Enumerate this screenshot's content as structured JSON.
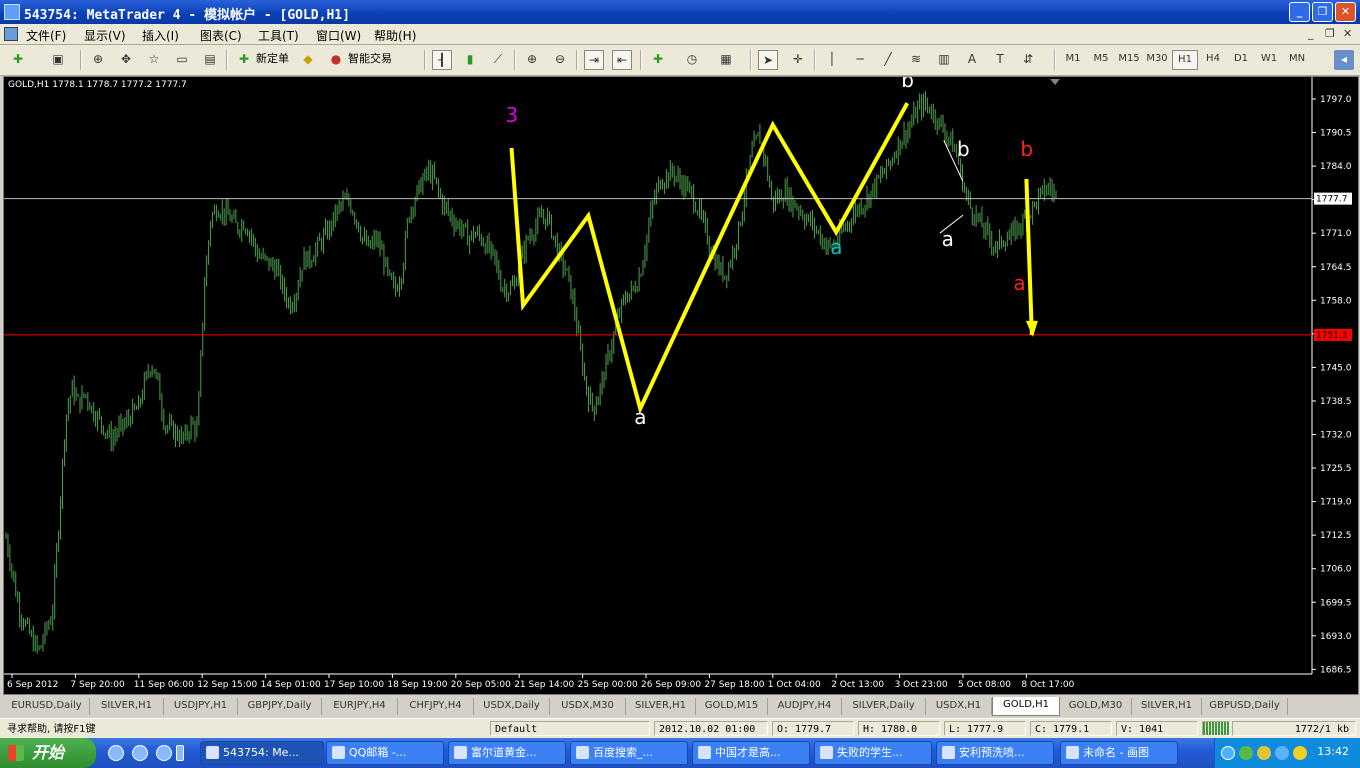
{
  "window": {
    "title": "543754: MetaTrader 4 - 模拟帐户 - [GOLD,H1]"
  },
  "menu": [
    {
      "key": "file",
      "label": "文件(F)"
    },
    {
      "key": "view",
      "label": "显示(V)"
    },
    {
      "key": "insert",
      "label": "插入(I)"
    },
    {
      "key": "charts",
      "label": "图表(C)"
    },
    {
      "key": "tools",
      "label": "工具(T)"
    },
    {
      "key": "window",
      "label": "窗口(W)"
    },
    {
      "key": "help",
      "label": "帮助(H)"
    }
  ],
  "toolbar": {
    "new_order": "新定单",
    "expert_advisors": "智能交易",
    "timeframes": [
      "M1",
      "M5",
      "M15",
      "M30",
      "H1",
      "H4",
      "D1",
      "W1",
      "MN"
    ],
    "active_timeframe": "H1",
    "text_tool": "A",
    "icons": [
      "new-chart-icon",
      "profiles-icon",
      "market-watch-icon",
      "navigator-icon",
      "terminal-icon",
      "strategy-tester-icon",
      "new-order-icon",
      "alert-icon",
      "expert-advisors-icon",
      "bar-chart-icon",
      "candlestick-icon",
      "line-chart-icon",
      "zoom-in-icon",
      "zoom-out-icon",
      "chart-shift-icon",
      "autoscroll-icon",
      "indicators-icon",
      "periods-icon",
      "templates-icon",
      "cursor-icon",
      "crosshair-icon",
      "vertical-line-icon",
      "horizontal-line-icon",
      "trendline-icon",
      "fibonacci-icon",
      "text-label-icon",
      "arrows-icon",
      "expand-icon"
    ]
  },
  "chart": {
    "symbol_info": "GOLD,H1  1778.1 1778.7 1777.2 1777.7",
    "current_price_label": "1777.7",
    "red_line_label": "1751.3",
    "colors": {
      "background": "#000000",
      "bars": "#4fa04f",
      "wave": "#ffff00",
      "red_line": "#ff0000",
      "price_line": "#bfbfbf",
      "axis_text": "#ffffff"
    }
  },
  "chart_data": {
    "type": "bar",
    "symbol": "GOLD",
    "timeframe": "H1",
    "ylim": [
      1684.4,
      1800.3
    ],
    "y_ticks": [
      "1797.0",
      "1790.5",
      "1784.0",
      "1777.4",
      "1771.0",
      "1764.5",
      "1758.0",
      "1751.3",
      "1745.0",
      "1738.5",
      "1732.0",
      "1725.5",
      "1719.0",
      "1712.5",
      "1706.0",
      "1699.5",
      "1693.0",
      "1686.5"
    ],
    "x_ticks": [
      "6 Sep 2012",
      "7 Sep 20:00",
      "11 Sep 06:00",
      "12 Sep 15:00",
      "14 Sep 01:00",
      "17 Sep 10:00",
      "18 Sep 19:00",
      "20 Sep 05:00",
      "21 Sep 14:00",
      "25 Sep 00:00",
      "26 Sep 09:00",
      "27 Sep 18:00",
      "1 Oct 04:00",
      "2 Oct 13:00",
      "3 Oct 23:00",
      "5 Oct 08:00",
      "8 Oct 17:00"
    ],
    "close_profile": [
      1712,
      1705,
      1698,
      1695,
      1692,
      1690,
      1694,
      1697,
      1715,
      1735,
      1741,
      1738,
      1740,
      1737,
      1735,
      1733,
      1731,
      1733,
      1734,
      1736,
      1737,
      1742,
      1746,
      1742,
      1734,
      1733,
      1732,
      1731,
      1734,
      1733,
      1760,
      1774,
      1776,
      1775,
      1774,
      1772,
      1773,
      1771,
      1767,
      1766,
      1765,
      1764,
      1760,
      1757,
      1760,
      1766,
      1766,
      1768,
      1770,
      1772,
      1775,
      1777,
      1777,
      1774,
      1770,
      1768,
      1770,
      1767,
      1762,
      1760,
      1764,
      1775,
      1778,
      1781,
      1783,
      1781,
      1777,
      1775,
      1773,
      1772,
      1770,
      1771,
      1770,
      1768,
      1766,
      1761,
      1760,
      1761,
      1766,
      1770,
      1772,
      1774,
      1774,
      1770,
      1766,
      1763,
      1757,
      1748,
      1740,
      1737,
      1741,
      1746,
      1751,
      1756,
      1759,
      1760,
      1763,
      1770,
      1777,
      1781,
      1782,
      1783,
      1781,
      1780,
      1778,
      1775,
      1771,
      1767,
      1764,
      1763,
      1767,
      1772,
      1780,
      1787,
      1790,
      1785,
      1777,
      1778,
      1779,
      1777,
      1776,
      1774,
      1773,
      1771,
      1769,
      1768,
      1770,
      1772,
      1774,
      1776,
      1777,
      1779,
      1781,
      1783,
      1785,
      1788,
      1790,
      1792,
      1795,
      1796,
      1795,
      1793,
      1791,
      1789,
      1786,
      1780,
      1776,
      1774,
      1772,
      1770,
      1768,
      1770,
      1770,
      1772,
      1773,
      1775,
      1777,
      1779,
      1780,
      1778
    ],
    "current_price": 1777.7,
    "red_line_price": 1751.3,
    "wave_path": [
      {
        "t": "21 Sep 10:00",
        "price": 1787.5
      },
      {
        "t": "21 Sep 19:00",
        "price": 1757.0
      },
      {
        "t": "25 Sep 03:00",
        "price": 1774.4
      },
      {
        "t": "26 Sep 06:00",
        "price": 1737.0
      },
      {
        "t": "1 Oct 04:00",
        "price": 1792.0
      },
      {
        "t": "2 Oct 13:00",
        "price": 1771.2
      },
      {
        "t": "4 Oct 03:00",
        "price": 1796.2
      }
    ],
    "drop_arrow": [
      {
        "t": "8 Oct 17:00",
        "price": 1781.5
      },
      {
        "t": "9 Oct 00:00",
        "price": 1751.3
      }
    ],
    "annotations": [
      {
        "text": "3",
        "color": "#e000e0",
        "t": "21 Sep 10:00",
        "price": 1792.5
      },
      {
        "text": "a",
        "color": "#ffffff",
        "t": "26 Sep 06:00",
        "price": 1734.0
      },
      {
        "text": "b",
        "color": "#ffffff",
        "t": "4 Oct 03:00",
        "price": 1799.3
      },
      {
        "text": "a",
        "color": "#00c0c0",
        "t": "2 Oct 13:00",
        "price": 1767.0
      },
      {
        "text": "b",
        "color": "#ffffff",
        "t": "5 Oct 08:00",
        "price": 1786.0
      },
      {
        "text": "a",
        "color": "#ffffff",
        "t": "5 Oct 00:00",
        "price": 1768.5
      },
      {
        "text": "b",
        "color": "#ff2020",
        "t": "8 Oct 17:00",
        "price": 1786.0
      },
      {
        "text": "a",
        "color": "#ff2020",
        "t": "8 Oct 08:00",
        "price": 1760.0
      }
    ]
  },
  "tabs": [
    {
      "label": "EURUSD,Daily",
      "active": false
    },
    {
      "label": "SILVER,H1",
      "active": false
    },
    {
      "label": "USDJPY,H1",
      "active": false
    },
    {
      "label": "GBPJPY,Daily",
      "active": false
    },
    {
      "label": "EURJPY,H4",
      "active": false
    },
    {
      "label": "CHFJPY,H4",
      "active": false
    },
    {
      "label": "USDX,Daily",
      "active": false
    },
    {
      "label": "USDX,M30",
      "active": false
    },
    {
      "label": "SILVER,H1",
      "active": false
    },
    {
      "label": "GOLD,M15",
      "active": false
    },
    {
      "label": "AUDJPY,H4",
      "active": false
    },
    {
      "label": "SILVER,Daily",
      "active": false
    },
    {
      "label": "USDX,H1",
      "active": false
    },
    {
      "label": "GOLD,H1",
      "active": true
    },
    {
      "label": "GOLD,M30",
      "active": false
    },
    {
      "label": "SILVER,H1",
      "active": false
    },
    {
      "label": "GBPUSD,Daily",
      "active": false
    }
  ],
  "status": {
    "help": "寻求帮助, 请按F1键",
    "profile": "Default",
    "datetime": "2012.10.02 01:00",
    "open": "O: 1779.7",
    "high": "H: 1780.0",
    "low": "L: 1777.9",
    "close": "C: 1779.1",
    "volume": "V: 1041",
    "traffic": "1772/1 kb"
  },
  "taskbar": {
    "start_label": "开始",
    "tasks": [
      {
        "label": "543754: Me..."
      },
      {
        "label": "QQ邮箱 -..."
      },
      {
        "label": "富尔道黄金..."
      },
      {
        "label": "百度搜索_..."
      },
      {
        "label": "中国才是高..."
      },
      {
        "label": "失败的学生..."
      },
      {
        "label": "安利预洗喷..."
      },
      {
        "label": "未命名 - 画图"
      }
    ],
    "clock": "13:42"
  }
}
